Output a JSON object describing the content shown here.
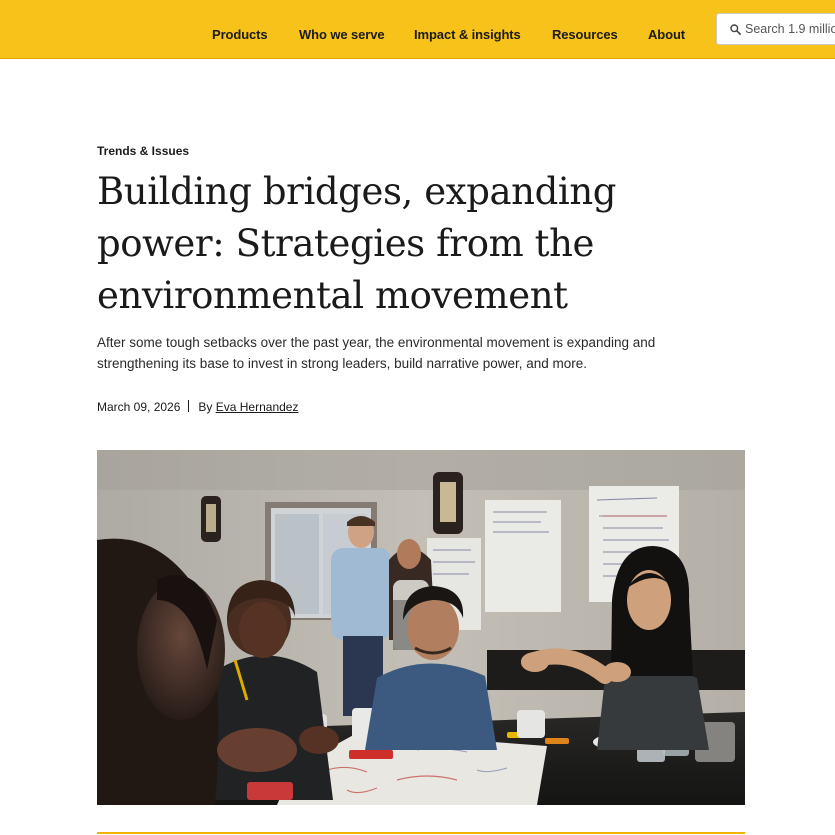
{
  "nav": {
    "items": [
      {
        "label": "Products"
      },
      {
        "label": "Who we serve"
      },
      {
        "label": "Impact & insights"
      },
      {
        "label": "Resources"
      },
      {
        "label": "About"
      }
    ],
    "search": {
      "placeholder": "Search 1.9 millio"
    },
    "icons": {
      "search": "search-icon"
    }
  },
  "article": {
    "category": "Trends & Issues",
    "title": "Building bridges, expanding power: Strategies from the environmental movement",
    "deck": "After some tough setbacks over the past year, the environmental movement is expanding and strengthening its base to invest in strong leaders, build narrative power, and more.",
    "date": "March 09, 2026",
    "by_prefix": "By",
    "author": "Eva Hernandez"
  },
  "colors": {
    "brand_yellow": "#f7c21a",
    "text": "#1a1a1a",
    "rule": "#f0b400"
  }
}
